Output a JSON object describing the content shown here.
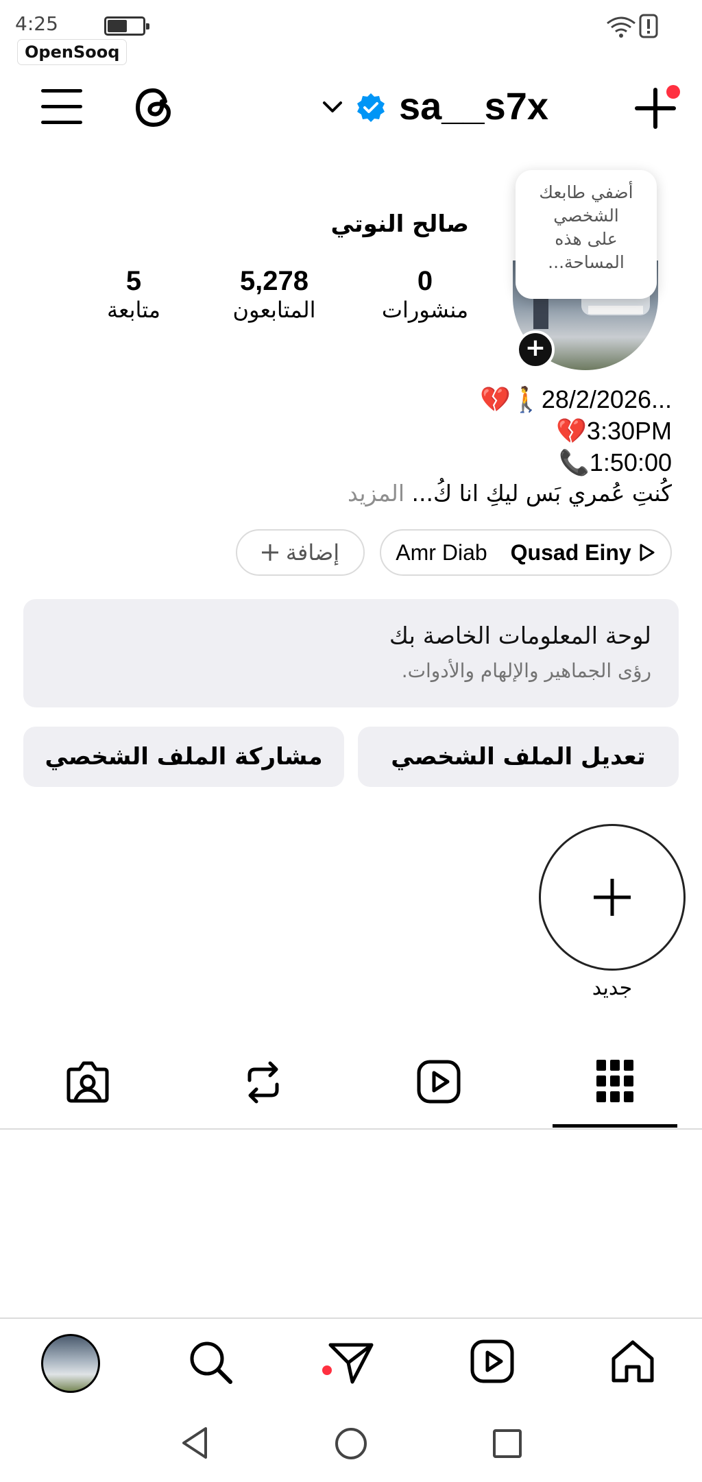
{
  "status_bar": {
    "time": "4:25",
    "watermark": "OpenSooq"
  },
  "header": {
    "username": "sa__s7x",
    "menu_icon": "hamburger-icon",
    "threads_icon": "threads-icon",
    "verified_icon": "verified-badge-icon",
    "create_icon": "plus-icon",
    "accent_color": "#0095f6",
    "notification_color": "#ff3040"
  },
  "profile": {
    "display_name": "صالح النوتي",
    "tooltip": [
      "أضفي طابعك",
      "الشخصي",
      "على هذه",
      "المساحة..."
    ],
    "stats": {
      "posts": {
        "value": "0",
        "label": "منشورات"
      },
      "followers": {
        "value": "5,278",
        "label": "المتابعون"
      },
      "following": {
        "value": "5",
        "label": "متابعة"
      }
    },
    "bio": {
      "line1_text": "28/2/2026...",
      "line2_text": "3:30PM",
      "line3_text": "1:50:00",
      "line4_text": "كُنتِ عُمري بَس ليكِ انا كُ...",
      "more": "المزيد"
    }
  },
  "music": {
    "song": "Qusad Einy",
    "artist": "Amr Diab"
  },
  "add_pill": {
    "label": "إضافة"
  },
  "dashboard": {
    "title": "لوحة المعلومات الخاصة بك",
    "subtitle": "رؤى الجماهير والإلهام والأدوات."
  },
  "buttons": {
    "edit": "تعديل الملف الشخصي",
    "share": "مشاركة الملف الشخصي"
  },
  "highlights": {
    "new_label": "جديد"
  },
  "tabs": [
    "grid-icon",
    "reels-icon",
    "reposts-icon",
    "tagged-icon"
  ],
  "bottom_nav": [
    "home-icon",
    "reels-icon",
    "direct-icon",
    "search-icon",
    "profile-avatar"
  ]
}
